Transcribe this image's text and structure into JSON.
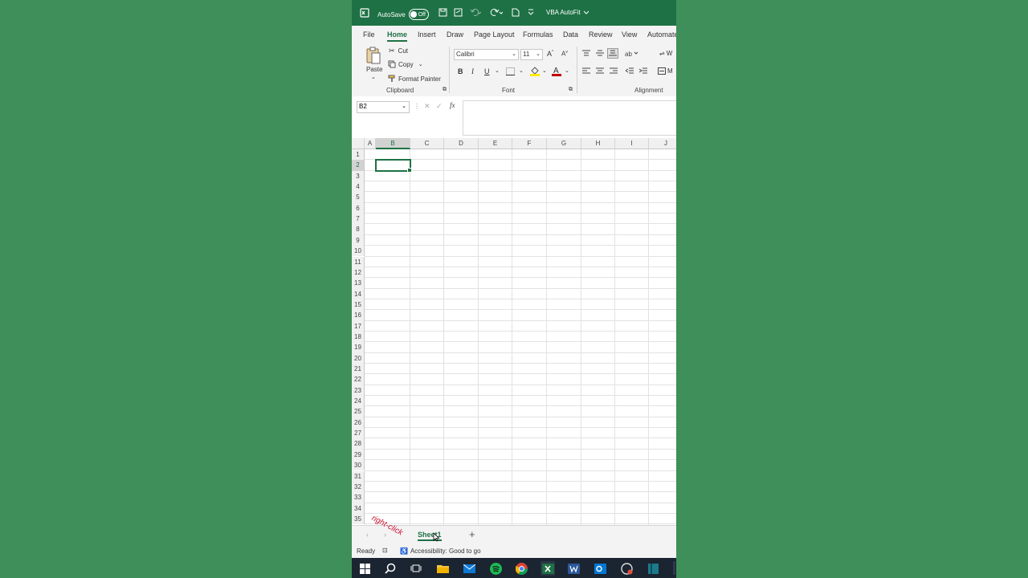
{
  "titlebar": {
    "autosave_label": "AutoSave",
    "autosave_state": "Off",
    "doc_title": "VBA AutoFit"
  },
  "tabs": [
    "File",
    "Home",
    "Insert",
    "Draw",
    "Page Layout",
    "Formulas",
    "Data",
    "Review",
    "View",
    "Automate"
  ],
  "ribbon": {
    "clipboard": {
      "paste": "Paste",
      "cut": "Cut",
      "copy": "Copy",
      "format_painter": "Format Painter",
      "label": "Clipboard"
    },
    "font": {
      "font_name": "Calibri",
      "font_size": "11",
      "bold": "B",
      "italic": "I",
      "underline": "U",
      "grow": "A",
      "shrink": "A",
      "label": "Font"
    },
    "alignment": {
      "label": "Alignment",
      "wrap": "W",
      "merge": "M"
    }
  },
  "formula_bar": {
    "name_box": "B2",
    "fx": "fx",
    "value": ""
  },
  "grid": {
    "columns": [
      "A",
      "B",
      "C",
      "D",
      "E",
      "F",
      "G",
      "H",
      "I",
      "J"
    ],
    "rows": [
      "1",
      "2",
      "3",
      "4",
      "5",
      "6",
      "7",
      "8",
      "9",
      "10",
      "11",
      "12",
      "13",
      "14",
      "15",
      "16",
      "17",
      "18",
      "19",
      "20",
      "21",
      "22",
      "23",
      "24",
      "25",
      "26",
      "27",
      "28",
      "29",
      "30",
      "31",
      "32",
      "33",
      "34",
      "35"
    ],
    "active_cell": "B2"
  },
  "sheets": {
    "tabs": [
      "Sheet1"
    ],
    "add": "+",
    "annotation": "right-click"
  },
  "status": {
    "ready": "Ready",
    "accessibility": "Accessibility: Good to go"
  },
  "colors": {
    "excel_green": "#1e7145",
    "background": "#3f8f5a",
    "taskbar": "#1b2431",
    "annotation": "#c8102e"
  },
  "taskbar_icons": [
    "windows-icon",
    "search-icon",
    "task-view-icon",
    "file-explorer-icon",
    "mail-icon",
    "spotify-icon",
    "chrome-icon",
    "excel-icon",
    "word-icon",
    "outlook-icon",
    "screen-recorder-icon",
    "app-icon"
  ]
}
